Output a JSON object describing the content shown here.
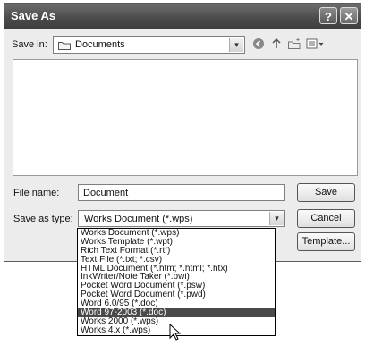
{
  "window": {
    "title": "Save As",
    "help_glyph": "?",
    "close_glyph": "✕"
  },
  "save_in": {
    "label": "Save in:",
    "value": "Documents",
    "folder_icon": "folder-icon"
  },
  "toolbar": {
    "back_icon": "back-icon",
    "up_icon": "up-folder-icon",
    "new_folder_icon": "new-folder-icon",
    "views_icon": "views-menu-icon"
  },
  "file_name": {
    "label": "File name:",
    "value": "Document"
  },
  "save_as_type": {
    "label": "Save as type:",
    "value": "Works Document (*.wps)"
  },
  "buttons": {
    "save": "Save",
    "cancel": "Cancel",
    "template": "Template..."
  },
  "type_options": [
    "Works Document (*.wps)",
    "Works Template (*.wpt)",
    "Rich Text Format (*.rtf)",
    "Text File (*.txt; *.csv)",
    "HTML Document (*.htm; *.html; *.htx)",
    "InkWriter/Note Taker (*.pwi)",
    "Pocket Word Document (*.psw)",
    "Pocket Word Document (*.pwd)",
    "Word 6.0/95 (*.doc)",
    "Word 97-2003 (*.doc)",
    "Works 2000 (*.wps)",
    "Works 4.x (*.wps)"
  ],
  "selected_option": "Word 97-2003 (*.doc)",
  "colors": {
    "title_bar": "#4a4a4a",
    "dialog_bg": "#ececec",
    "selection": "#4a4a4a"
  }
}
